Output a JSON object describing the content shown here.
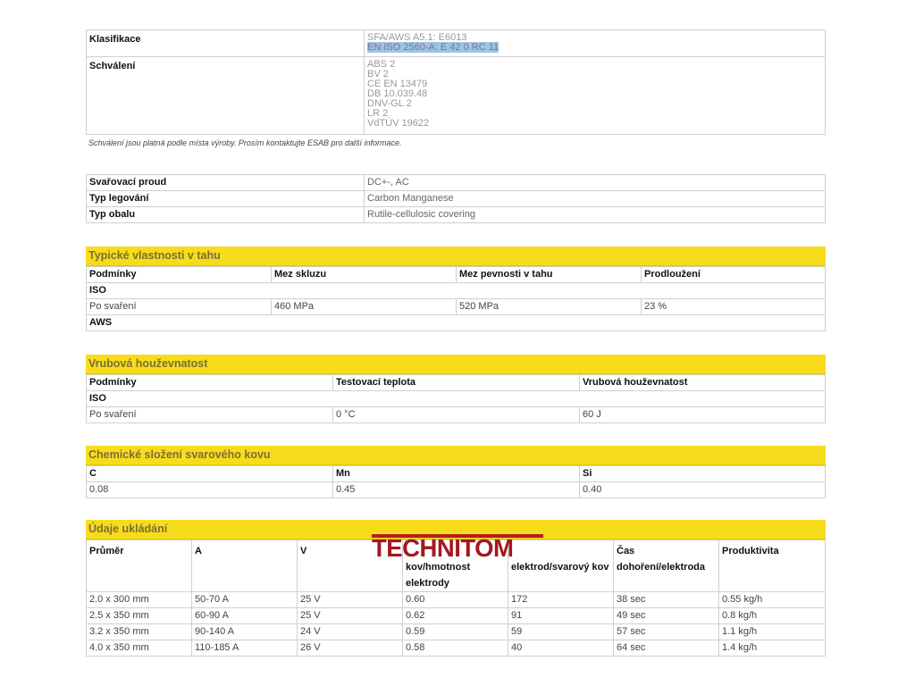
{
  "spec": {
    "klasifikace_label": "Klasifikace",
    "klasifikace_values": [
      "SFA/AWS A5.1: E6013",
      "EN ISO 2560-A: E 42 0 RC 11"
    ],
    "schvaleni_label": "Schválení",
    "schvaleni_values": [
      "ABS 2",
      "BV 2",
      "CE EN 13479",
      "DB 10.039.48",
      "DNV-GL 2",
      "LR 2",
      "VdTÜV 19622"
    ],
    "note": "Schválení jsou platná podle místa výroby. Prosím kontaktujte ESAB pro další informace."
  },
  "process": [
    {
      "label": "Svařovací proud",
      "value": "DC+-, AC"
    },
    {
      "label": "Typ legování",
      "value": "Carbon Manganese"
    },
    {
      "label": "Typ obalu",
      "value": "Rutile-cellulosic covering"
    }
  ],
  "tensile": {
    "title": "Typické vlastnosti v tahu",
    "headers": [
      "Podmínky",
      "Mez skluzu",
      "Mez pevnosti v tahu",
      "Prodloužení"
    ],
    "iso_label": "ISO",
    "row": [
      "Po svaření",
      "460 MPa",
      "520 MPa",
      "23 %"
    ],
    "aws_label": "AWS"
  },
  "impact": {
    "title": "Vrubová houževnatost",
    "headers": [
      "Podmínky",
      "Testovací teplota",
      "Vrubová houževnatost"
    ],
    "iso_label": "ISO",
    "row": [
      "Po svaření",
      "0 °C",
      "60 J"
    ]
  },
  "chemistry": {
    "title": "Chemické složení svarového kovu",
    "headers": [
      "C",
      "Mn",
      "Si"
    ],
    "row": [
      "0.08",
      "0.45",
      "0.40"
    ]
  },
  "deposition": {
    "title": "Údaje ukládání",
    "headers": [
      "Průměr",
      "A",
      "V",
      "kov/hmotnost elektrody",
      "elektrod/svarový kov",
      "Čas dohoření/elektroda",
      "Produktivita"
    ],
    "rows": [
      [
        "2.0 x 300 mm",
        "50-70 A",
        "25 V",
        "0.60",
        "172",
        "38 sec",
        "0.55 kg/h"
      ],
      [
        "2.5 x 350 mm",
        "60-90 A",
        "25 V",
        "0.62",
        "91",
        "49 sec",
        "0.8 kg/h"
      ],
      [
        "3.2 x 350 mm",
        "90-140 A",
        "24 V",
        "0.59",
        "59",
        "57 sec",
        "1.1 kg/h"
      ],
      [
        "4.0 x 350 mm",
        "110-185 A",
        "26 V",
        "0.58",
        "40",
        "64 sec",
        "1.4 kg/h"
      ]
    ]
  },
  "logo": {
    "text": "TECHNITOM",
    "color": "#a3181e"
  },
  "colors": {
    "accent_yellow": "#f7dc1c",
    "selection_blue": "#9ec3e6"
  }
}
